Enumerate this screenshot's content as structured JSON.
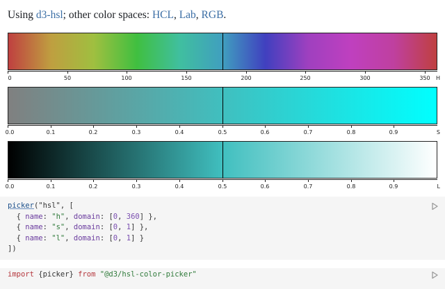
{
  "intro": {
    "prefix": "Using ",
    "link_current": "d3-hsl",
    "middle": "; other color spaces: ",
    "link_hcl": "HCL",
    "sep1": ", ",
    "link_lab": "Lab",
    "sep2": ", ",
    "link_rgb": "RGB",
    "suffix": "."
  },
  "pickers": [
    {
      "channel": "h",
      "channel_label": "H",
      "domain": [
        0,
        360
      ],
      "value": 180,
      "gradient": [
        "#bf4040",
        "#bf9f40",
        "#9fbf40",
        "#40bf40",
        "#40bf9f",
        "#409fbf",
        "#4040bf",
        "#9f40bf",
        "#bf40bf",
        "#bf409f",
        "#bf4040"
      ],
      "ticks": [
        "0",
        "50",
        "100",
        "150",
        "200",
        "250",
        "300",
        "350"
      ],
      "tick_values": [
        0,
        50,
        100,
        150,
        200,
        250,
        300,
        350
      ]
    },
    {
      "channel": "s",
      "channel_label": "S",
      "domain": [
        0,
        1
      ],
      "value": 0.5,
      "gradient": [
        "#808080",
        "#40bfbf",
        "#00ffff"
      ],
      "ticks": [
        "0.0",
        "0.1",
        "0.2",
        "0.3",
        "0.4",
        "0.5",
        "0.6",
        "0.7",
        "0.8",
        "0.9"
      ],
      "tick_values": [
        0,
        0.1,
        0.2,
        0.3,
        0.4,
        0.5,
        0.6,
        0.7,
        0.8,
        0.9
      ]
    },
    {
      "channel": "l",
      "channel_label": "L",
      "domain": [
        0,
        1
      ],
      "value": 0.5,
      "gradient": [
        "#000000",
        "#40bfbf",
        "#ffffff"
      ],
      "ticks": [
        "0.0",
        "0.1",
        "0.2",
        "0.3",
        "0.4",
        "0.5",
        "0.6",
        "0.7",
        "0.8",
        "0.9"
      ],
      "tick_values": [
        0,
        0.1,
        0.2,
        0.3,
        0.4,
        0.5,
        0.6,
        0.7,
        0.8,
        0.9
      ]
    }
  ],
  "code_cell": {
    "fn": "picker",
    "open": "(\"hsl\", [",
    "rows": [
      {
        "indent": "  { ",
        "k1": "name",
        "c1": ": ",
        "v1": "\"h\"",
        "c2": ", ",
        "k2": "domain",
        "c3": ": [",
        "d0": "0",
        "c4": ", ",
        "d1": "360",
        "end": "] },"
      },
      {
        "indent": "  { ",
        "k1": "name",
        "c1": ": ",
        "v1": "\"s\"",
        "c2": ", ",
        "k2": "domain",
        "c3": ": [",
        "d0": "0",
        "c4": ", ",
        "d1": "1",
        "end": "] },"
      },
      {
        "indent": "  { ",
        "k1": "name",
        "c1": ": ",
        "v1": "\"l\"",
        "c2": ", ",
        "k2": "domain",
        "c3": ": [",
        "d0": "0",
        "c4": ", ",
        "d1": "1",
        "end": "] }"
      }
    ],
    "close": "])"
  },
  "import_cell": {
    "kw": "import",
    "body": " {picker} ",
    "kw_from": "from",
    "module": " \"@d3/hsl-color-picker\""
  },
  "icons": {
    "run": "run-play-icon"
  }
}
